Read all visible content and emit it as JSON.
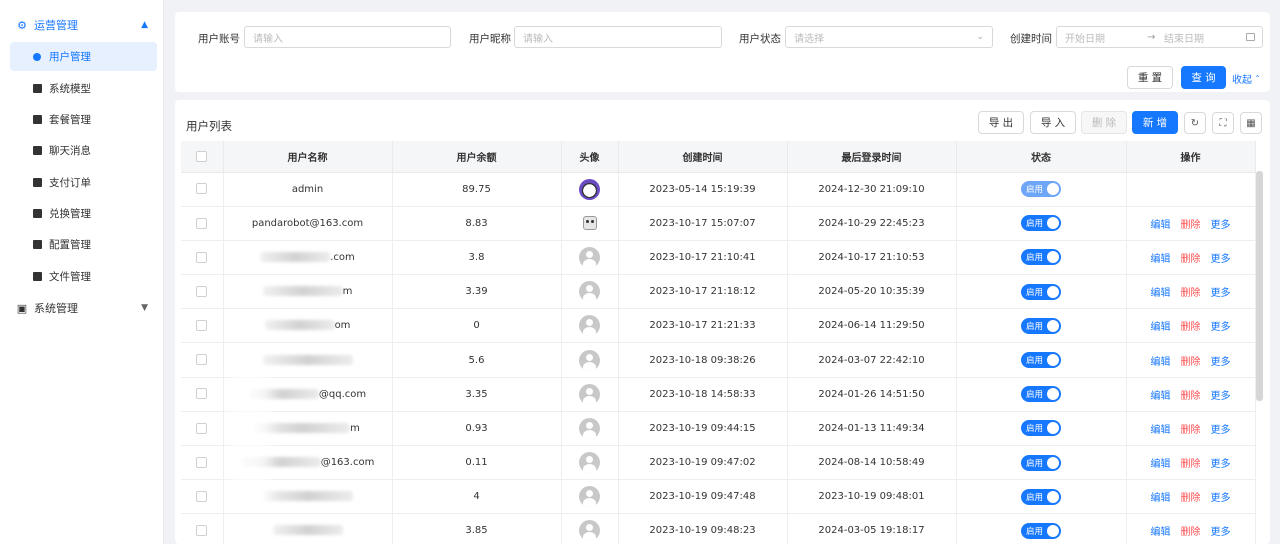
{
  "sidebar": {
    "group_ops": {
      "label": "运营管理",
      "icon": "users-icon"
    },
    "items": [
      {
        "label": "用户管理",
        "icon": "user-icon",
        "active": true
      },
      {
        "label": "系统模型",
        "icon": "model-icon"
      },
      {
        "label": "套餐管理",
        "icon": "package-icon"
      },
      {
        "label": "聊天消息",
        "icon": "chat-icon"
      },
      {
        "label": "支付订单",
        "icon": "order-icon"
      },
      {
        "label": "兑换管理",
        "icon": "exchange-icon"
      },
      {
        "label": "配置管理",
        "icon": "config-icon"
      },
      {
        "label": "文件管理",
        "icon": "folder-icon"
      }
    ],
    "group_sys": {
      "label": "系统管理",
      "icon": "monitor-icon"
    }
  },
  "search": {
    "account_label": "用户账号",
    "account_placeholder": "请输入",
    "nickname_label": "用户昵称",
    "nickname_placeholder": "请输入",
    "status_label": "用户状态",
    "status_placeholder": "请选择",
    "created_label": "创建时间",
    "start_placeholder": "开始日期",
    "range_arrow": "→",
    "end_placeholder": "结束日期",
    "reset": "重 置",
    "query": "查 询",
    "collapse": "收起"
  },
  "list": {
    "title": "用户列表",
    "export": "导 出",
    "import": "导 入",
    "delete": "删 除",
    "add": "新 增",
    "columns": [
      "用户名称",
      "用户余额",
      "头像",
      "创建时间",
      "最后登录时间",
      "状态",
      "操作"
    ],
    "status_on": "启用",
    "actions": {
      "edit": "编辑",
      "delete": "删除",
      "more": "更多"
    },
    "rows": [
      {
        "name": "admin",
        "balance": "89.75",
        "created": "2023-05-14 15:19:39",
        "last_login": "2024-12-30 21:09:10"
      },
      {
        "name": "pandarobot@163.com",
        "balance": "8.83",
        "created": "2023-10-17 15:07:07",
        "last_login": "2024-10-29 22:45:23"
      },
      {
        "name": ".com",
        "balance": "3.8",
        "created": "2023-10-17 21:10:41",
        "last_login": "2024-10-17 21:10:53"
      },
      {
        "name": "m",
        "balance": "3.39",
        "created": "2023-10-17 21:18:12",
        "last_login": "2024-05-20 10:35:39"
      },
      {
        "name": "om",
        "balance": "0",
        "created": "2023-10-17 21:21:33",
        "last_login": "2024-06-14 11:29:50"
      },
      {
        "name": "",
        "balance": "5.6",
        "created": "2023-10-18 09:38:26",
        "last_login": "2024-03-07 22:42:10"
      },
      {
        "name": "@qq.com",
        "balance": "3.35",
        "created": "2023-10-18 14:58:33",
        "last_login": "2024-01-26 14:51:50"
      },
      {
        "name": "m",
        "balance": "0.93",
        "created": "2023-10-19 09:44:15",
        "last_login": "2024-01-13 11:49:34"
      },
      {
        "name": "@163.com",
        "balance": "0.11",
        "created": "2023-10-19 09:47:02",
        "last_login": "2024-08-14 10:58:49"
      },
      {
        "name": "",
        "balance": "4",
        "created": "2023-10-19 09:47:48",
        "last_login": "2023-10-19 09:48:01"
      },
      {
        "name": "",
        "balance": "3.85",
        "created": "2023-10-19 09:48:23",
        "last_login": "2024-03-05 19:18:17"
      }
    ]
  },
  "colors": {
    "accent": "#1677ff",
    "danger": "#ff4d4f"
  }
}
